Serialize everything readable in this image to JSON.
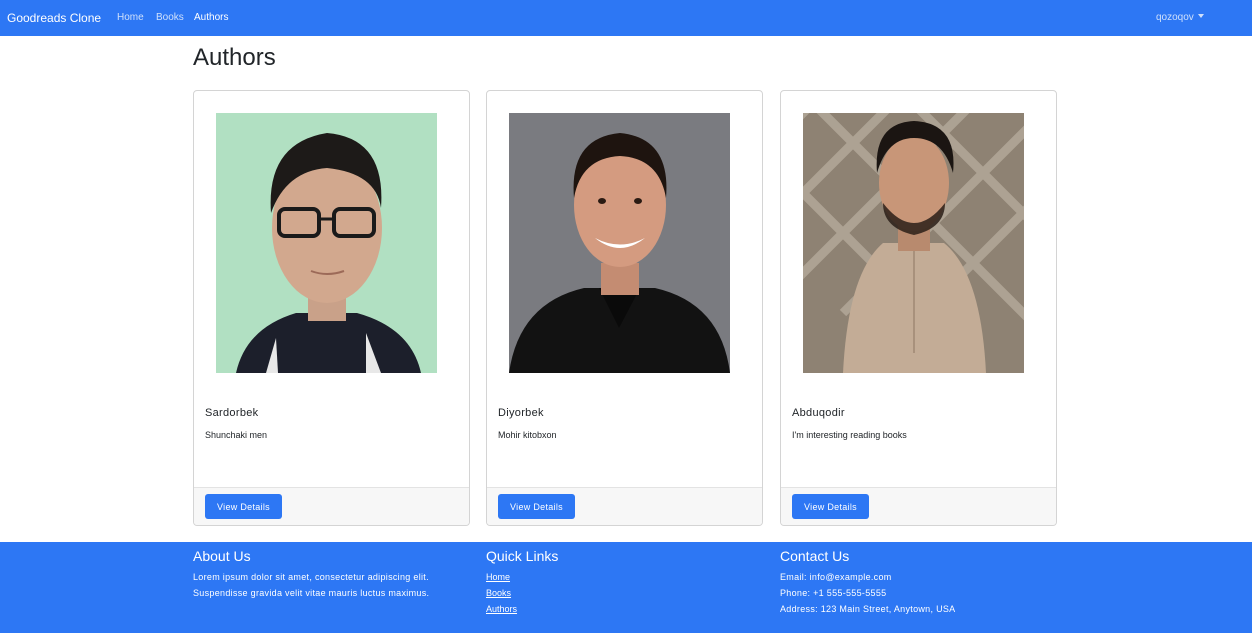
{
  "navbar": {
    "brand": "Goodreads Clone",
    "links": [
      {
        "label": "Home",
        "active": false
      },
      {
        "label": "Books",
        "active": false
      },
      {
        "label": "Authors",
        "active": true
      }
    ],
    "user": "qozoqov"
  },
  "page": {
    "title": "Authors"
  },
  "authors": [
    {
      "name": "Sardorbek",
      "description": "Shunchaki men",
      "button_label": "View Details"
    },
    {
      "name": "Diyorbek",
      "description": "Mohir kitobxon",
      "button_label": "View Details"
    },
    {
      "name": "Abduqodir",
      "description": "I'm interesting reading books",
      "button_label": "View Details"
    }
  ],
  "footer": {
    "about": {
      "heading": "About Us",
      "line1": "Lorem ipsum dolor sit amet, consectetur adipiscing elit.",
      "line2": "Suspendisse gravida velit vitae mauris luctus maximus."
    },
    "quick_links": {
      "heading": "Quick Links",
      "links": [
        "Home",
        "Books",
        "Authors"
      ]
    },
    "contact": {
      "heading": "Contact Us",
      "email": "Email: info@example.com",
      "phone": "Phone: +1 555-555-5555",
      "address": "Address: 123 Main Street, Anytown, USA"
    }
  },
  "colors": {
    "primary": "#2d77f4",
    "card_border": "#d4d4d4",
    "card_footer": "#f7f7f7"
  }
}
